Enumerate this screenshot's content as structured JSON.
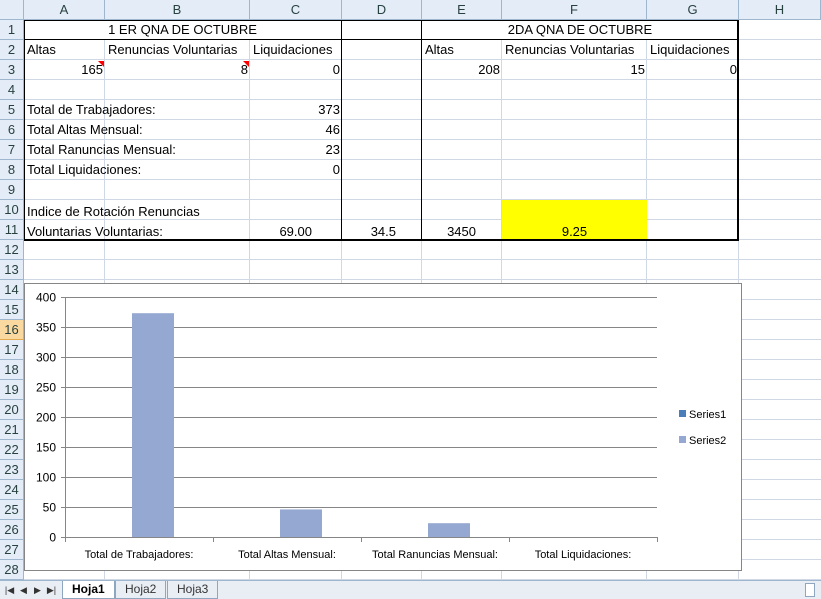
{
  "columns": [
    "A",
    "B",
    "C",
    "D",
    "E",
    "F",
    "G",
    "H"
  ],
  "rows": [
    "1",
    "2",
    "3",
    "4",
    "5",
    "6",
    "7",
    "8",
    "9",
    "10",
    "11",
    "12",
    "13",
    "14",
    "15",
    "16",
    "17",
    "18",
    "19",
    "20",
    "21",
    "22",
    "23",
    "24",
    "25",
    "26",
    "27",
    "28"
  ],
  "sheet": {
    "group1_title": "1 ER QNA DE OCTUBRE",
    "group2_title": "2DA QNA DE OCTUBRE",
    "h_altas": "Altas",
    "h_renuncias": "Renuncias Voluntarias",
    "h_liquid": "Liquidaciones",
    "v_a3": "165",
    "v_b3": "8",
    "v_c3": "0",
    "v_e3": "208",
    "v_f3": "15",
    "v_g3": "0",
    "l_total_trab": "Total de Trabajadores:",
    "v_total_trab": "373",
    "l_total_altas": "Total Altas Mensual:",
    "v_total_altas": "46",
    "l_total_ren": "Total Ranuncias Mensual:",
    "v_total_ren": "23",
    "l_total_liq": "Total Liquidaciones:",
    "v_total_liq": "0",
    "l_indice1": "Indice de Rotación Renuncias",
    "l_indice2": "Voluntarias Voluntarias:",
    "v_c11": "69.00",
    "v_d11": "34.5",
    "v_e11": "3450",
    "v_f11": "9.25"
  },
  "colors": {
    "highlight": "#ffff00",
    "series1": "#4a7ebb",
    "series2": "#95a8d1"
  },
  "tabs": {
    "t1": "Hoja1",
    "t2": "Hoja2",
    "t3": "Hoja3"
  },
  "chart_data": {
    "type": "bar",
    "categories": [
      "Total de Trabajadores:",
      "Total Altas Mensual:",
      "Total Ranuncias Mensual:",
      "Total Liquidaciones:"
    ],
    "series": [
      {
        "name": "Series1",
        "values": [
          0,
          0,
          0,
          0
        ]
      },
      {
        "name": "Series2",
        "values": [
          373,
          46,
          23,
          0
        ]
      }
    ],
    "ylim": [
      0,
      400
    ],
    "yticks": [
      "0",
      "50",
      "100",
      "150",
      "200",
      "250",
      "300",
      "350",
      "400"
    ],
    "grid": true,
    "legend": "right"
  }
}
